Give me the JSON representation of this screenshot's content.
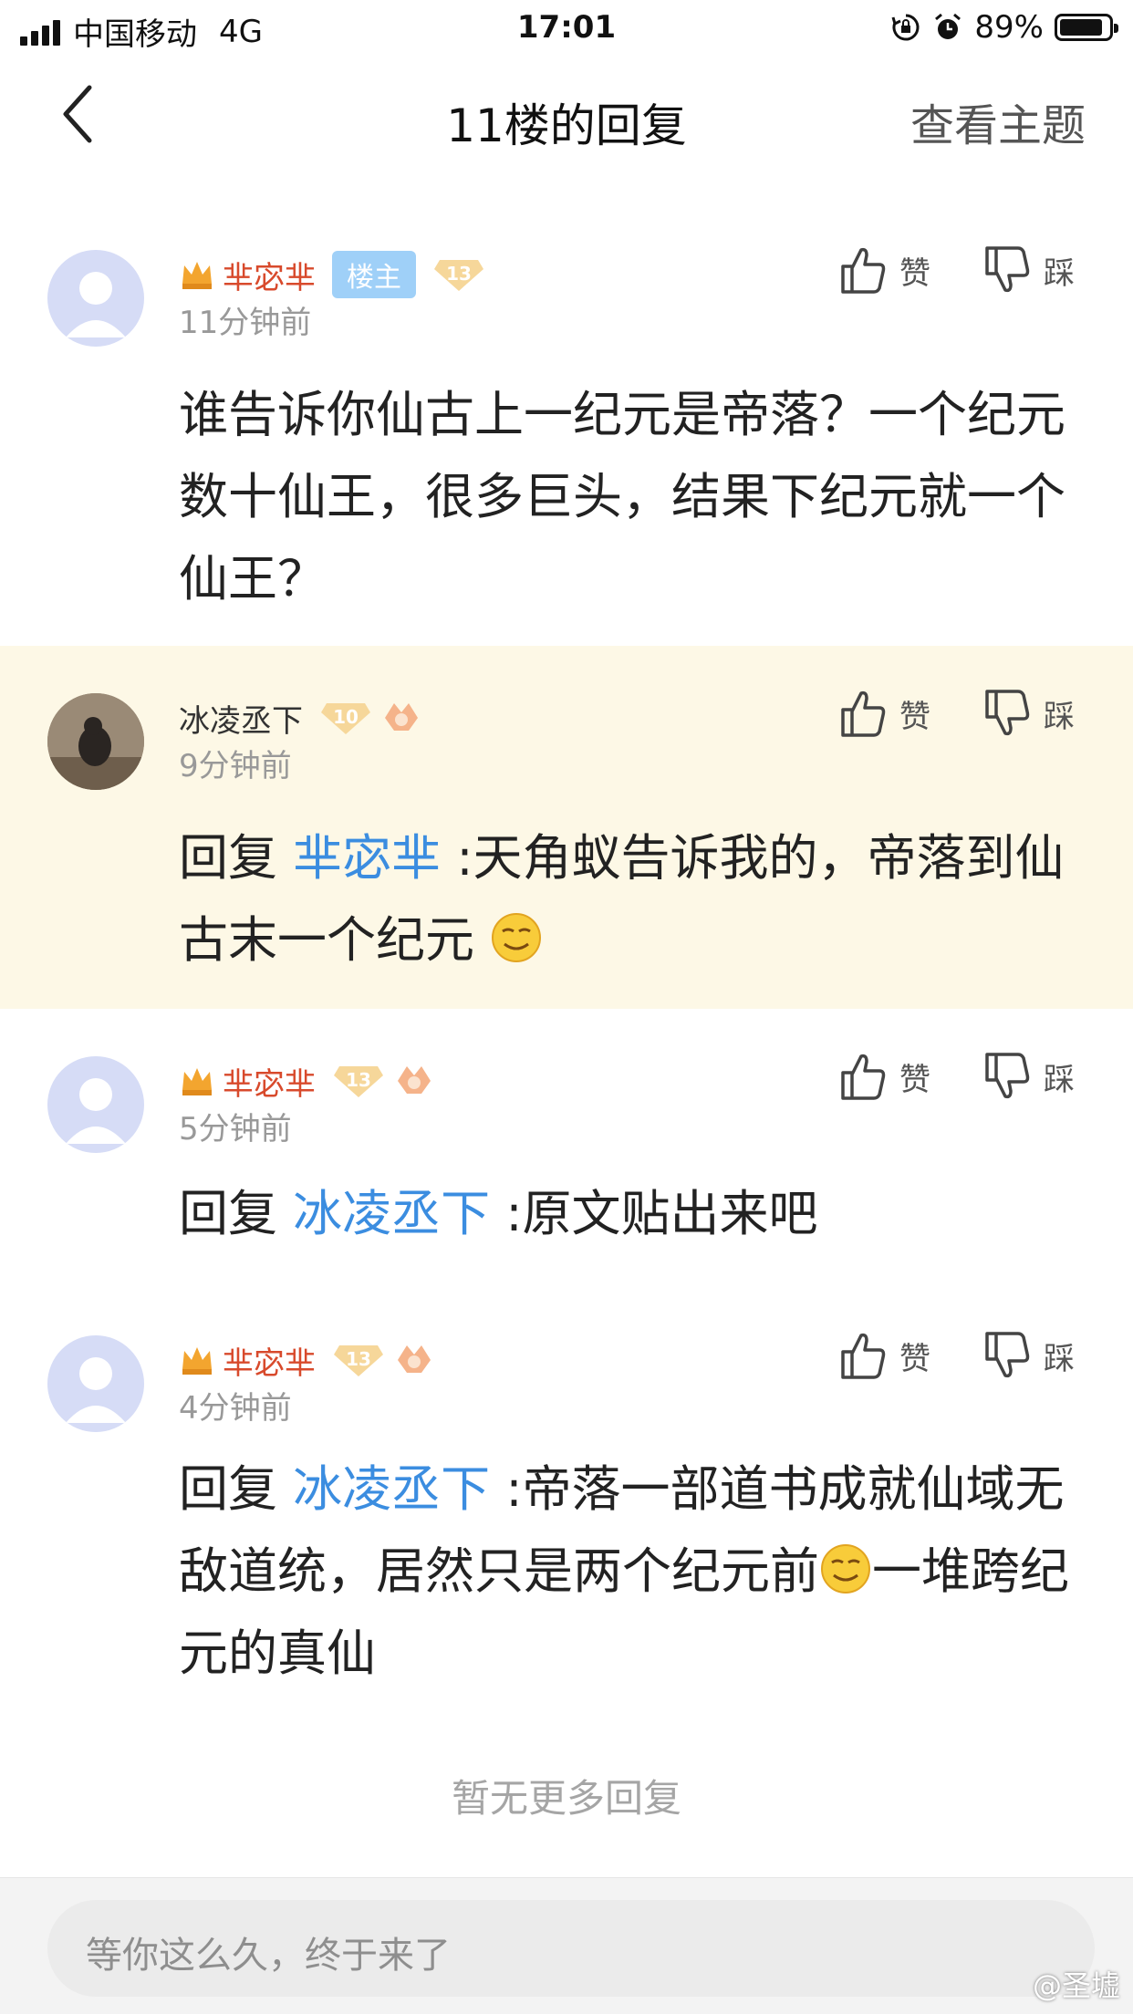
{
  "status_bar": {
    "carrier": "中国移动",
    "network": "4G",
    "time": "17:01",
    "battery": "89%"
  },
  "nav": {
    "title": "11楼的回复",
    "right": "查看主题"
  },
  "actions": {
    "like": "赞",
    "dislike": "踩"
  },
  "comments": [
    {
      "username": "芈宓芈",
      "owner_badge": "楼主",
      "level": "13",
      "time": "11分钟前",
      "text": "谁告诉你仙古上一纪元是帝落？一个纪元数十仙王，很多巨头，结果下纪元就一个仙王？"
    },
    {
      "username": "冰凌丞下",
      "level": "10",
      "time": "9分钟前",
      "reply_prefix": "回复 ",
      "reply_to": "芈宓芈",
      "text": " :天角蚁告诉我的，帝落到仙古末一个纪元 "
    },
    {
      "username": "芈宓芈",
      "level": "13",
      "time": "5分钟前",
      "reply_prefix": "回复 ",
      "reply_to": "冰凌丞下",
      "text": " :原文贴出来吧"
    },
    {
      "username": "芈宓芈",
      "level": "13",
      "time": "4分钟前",
      "reply_prefix": "回复 ",
      "reply_to": "冰凌丞下",
      "text": " :帝落一部道书成就仙域无敌道统，居然只是两个纪元前",
      "text_after_emoji": "一堆跨纪元的真仙"
    }
  ],
  "no_more": "暂无更多回复",
  "input": {
    "placeholder": "等你这么久，终于来了"
  },
  "watermark": "@圣墟",
  "colors": {
    "username_red": "#d84a2c",
    "reply_blue": "#3b8de0",
    "highlight_bg": "#fdf8e6"
  }
}
